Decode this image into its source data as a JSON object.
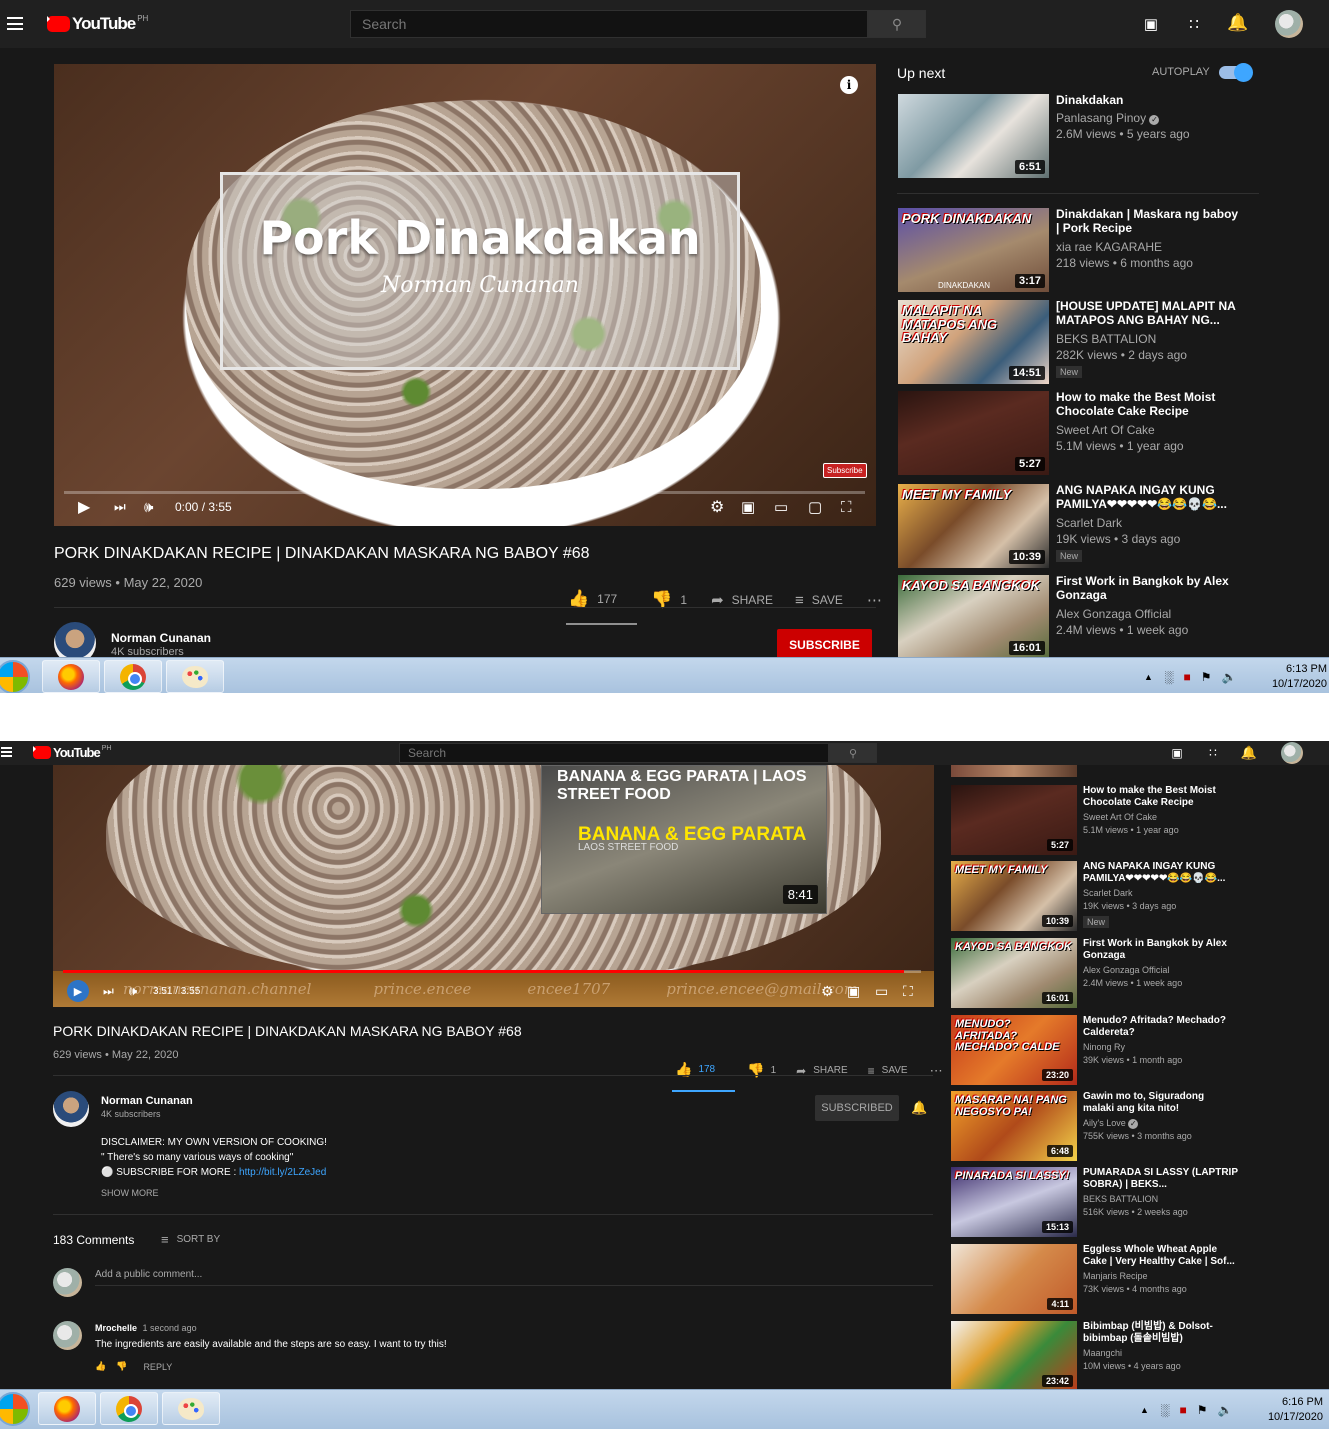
{
  "header": {
    "brand": "YouTube",
    "region": "PH",
    "search_placeholder": "Search"
  },
  "video": {
    "title": "PORK DINAKDAKAN RECIPE | DINAKDAKAN MASKARA NG BABOY #68",
    "card_title": "Pork Dinakdakan",
    "card_subtitle": "Norman Cunanan",
    "subscribe_badge": "Subscribe",
    "views_date": "629 views • May 22, 2020",
    "time_1": "0:00 / 3:55",
    "time_2": "3:51 / 3:55",
    "progress_1": 0,
    "progress_2": 0.98,
    "likes_1": "177",
    "likes_2": "178",
    "dislikes": "1",
    "share": "SHARE",
    "save": "SAVE",
    "endscreen_title": "BANANA & EGG PARATA | LAOS STREET FOOD",
    "endscreen_overlay": "BANANA & EGG PARATA",
    "endscreen_overlay_sub": "LAOS STREET FOOD",
    "endscreen_duration": "8:41",
    "social_links": [
      "normancunanan.channel",
      "prince.encee",
      "encee1707",
      "prince.encee@gmail.com"
    ]
  },
  "channel": {
    "name": "Norman Cunanan",
    "subs_1": "4K subscribers",
    "subs_2": "4K subscribers",
    "subscribe": "SUBSCRIBE",
    "subscribed": "SUBSCRIBED"
  },
  "description": {
    "line1": "DISCLAIMER:  MY OWN VERSION OF COOKING!",
    "line2": "\" There's so many various ways of cooking\"",
    "line3_prefix": "⚪ SUBSCRIBE FOR MORE : ",
    "line3_link": "http://bit.ly/2LZeJed",
    "show_more": "SHOW MORE"
  },
  "comments": {
    "count": "183 Comments",
    "sort_by": "SORT BY",
    "placeholder": "Add a public comment...",
    "items": [
      {
        "author": "Mrochelle",
        "time": "1 second ago",
        "text": "The ingredients are easily available and the steps are so easy. I want to try this!",
        "reply": "REPLY"
      }
    ]
  },
  "sidebar": {
    "up_next": "Up next",
    "autoplay": "AUTOPLAY",
    "autoplay_on": true,
    "list_1": [
      {
        "title": "Dinakdakan",
        "channel": "Panlasang Pinoy",
        "verified": true,
        "views": "2.6M views • 5 years ago",
        "duration": "6:51",
        "badge": ""
      },
      {
        "title": "Dinakdakan | Maskara ng baboy | Pork Recipe",
        "channel": "xia rae KAGARAHE",
        "verified": false,
        "views": "218 views • 6 months ago",
        "duration": "3:17",
        "badge": "",
        "thumb_text": "PORK DINAKDAKAN",
        "thumb_sub": "DINAKDAKAN"
      },
      {
        "title": "[HOUSE UPDATE] MALAPIT NA MATAPOS ANG BAHAY NG...",
        "channel": "BEKS BATTALION",
        "verified": false,
        "views": "282K views • 2 days ago",
        "duration": "14:51",
        "badge": "New",
        "thumb_text": "MALAPIT NA MATAPOS ANG BAHAY"
      },
      {
        "title": "How to make the Best Moist Chocolate Cake Recipe",
        "channel": "Sweet Art Of Cake",
        "verified": false,
        "views": "5.1M views • 1 year ago",
        "duration": "5:27",
        "badge": ""
      },
      {
        "title": "ANG NAPAKA INGAY KUNG PAMILYA❤❤❤❤❤😂😂💀😂...",
        "channel": "Scarlet Dark",
        "verified": false,
        "views": "19K views • 3 days ago",
        "duration": "10:39",
        "badge": "New",
        "thumb_text": "MEET MY FAMILY"
      },
      {
        "title": "First Work in Bangkok by Alex Gonzaga",
        "channel": "Alex Gonzaga Official",
        "verified": false,
        "views": "2.4M views • 1 week ago",
        "duration": "16:01",
        "badge": "",
        "thumb_text": "KAYOD SA BANGKOK"
      }
    ],
    "list_2": [
      {
        "title": "How to make the Best Moist Chocolate Cake Recipe",
        "channel": "Sweet Art Of Cake",
        "verified": false,
        "views": "5.1M views • 1 year ago",
        "duration": "5:27",
        "badge": ""
      },
      {
        "title": "ANG NAPAKA INGAY KUNG PAMILYA❤❤❤❤❤😂😂💀😂...",
        "channel": "Scarlet Dark",
        "verified": false,
        "views": "19K views • 3 days ago",
        "duration": "10:39",
        "badge": "New",
        "thumb_text": "MEET MY FAMILY"
      },
      {
        "title": "First Work in Bangkok by Alex Gonzaga",
        "channel": "Alex Gonzaga Official",
        "verified": false,
        "views": "2.4M views • 1 week ago",
        "duration": "16:01",
        "badge": "",
        "thumb_text": "KAYOD SA BANGKOK"
      },
      {
        "title": "Menudo? Afritada? Mechado? Caldereta?",
        "channel": "Ninong Ry",
        "verified": false,
        "views": "39K views • 1 month ago",
        "duration": "23:20",
        "badge": "",
        "thumb_text": "MENUDO? AFRITADA? MECHADO? CALDE"
      },
      {
        "title": "Gawin mo to, Siguradong malaki ang kita nito!",
        "channel": "Aily's Love",
        "verified": true,
        "views": "755K views • 3 months ago",
        "duration": "6:48",
        "badge": "",
        "thumb_text": "MASARAP NA! PANG NEGOSYO PA!"
      },
      {
        "title": "PUMARADA SI LASSY (LAPTRIP SOBRA) | BEKS...",
        "channel": "BEKS BATTALION",
        "verified": false,
        "views": "516K views • 2 weeks ago",
        "duration": "15:13",
        "badge": "",
        "thumb_text": "PINARADA SI LASSY!"
      },
      {
        "title": "Eggless Whole Wheat Apple Cake | Very Healthy Cake | Sof...",
        "channel": "Manjaris Recipe",
        "verified": false,
        "views": "73K views • 4 months ago",
        "duration": "4:11",
        "badge": ""
      },
      {
        "title": "Bibimbap (비빔밥) & Dolsot-bibimbap (돌솥비빔밥)",
        "channel": "Maangchi",
        "verified": false,
        "views": "10M views • 4 years ago",
        "duration": "23:42",
        "badge": ""
      }
    ]
  },
  "taskbar": {
    "time_1": "6:13 PM",
    "date_1": "10/17/2020",
    "time_2": "6:16 PM",
    "date_2": "10/17/2020"
  }
}
